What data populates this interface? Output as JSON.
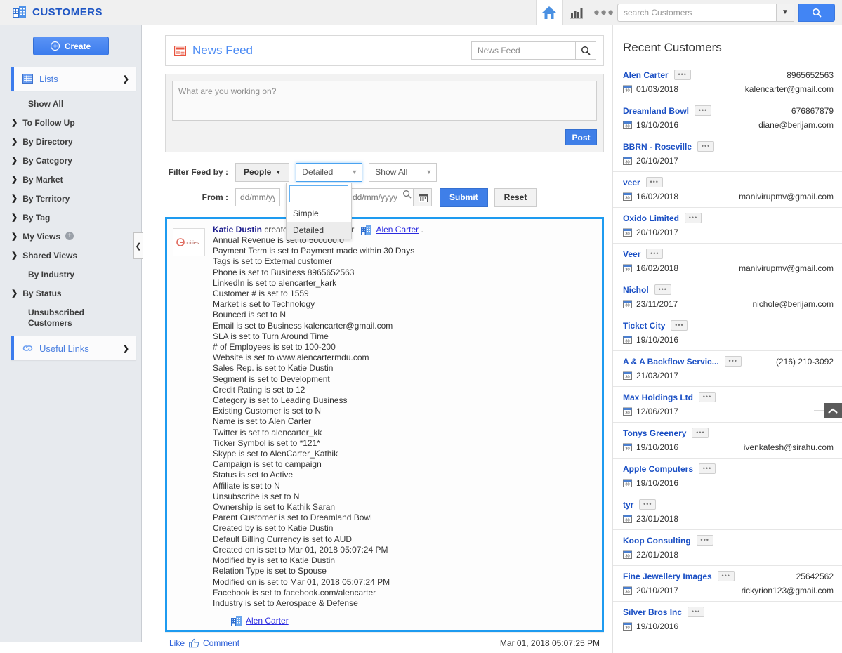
{
  "header": {
    "app_title": "CUSTOMERS",
    "brand_icon": "building-icon",
    "home_icon": "home-icon",
    "chart_icon": "bar-chart-icon",
    "more_icon": "more-dots-icon",
    "search_placeholder": "search Customers",
    "search_value": "",
    "search_caret_icon": "chevron-down-icon",
    "search_go_icon": "search-icon"
  },
  "sidebar": {
    "create_label": "Create",
    "create_icon": "plus-circle-icon",
    "lists_group": {
      "label": "Lists",
      "icon": "grid-icon",
      "chevron": "chevron-down-icon"
    },
    "items": [
      {
        "label": "Show All",
        "arrow": false
      },
      {
        "label": "To Follow Up",
        "arrow": true
      },
      {
        "label": "By Directory",
        "arrow": true
      },
      {
        "label": "By Category",
        "arrow": true
      },
      {
        "label": "By Market",
        "arrow": true
      },
      {
        "label": "By Territory",
        "arrow": true
      },
      {
        "label": "By Tag",
        "arrow": true
      },
      {
        "label": "My Views",
        "arrow": true,
        "plus": true
      },
      {
        "label": "Shared Views",
        "arrow": true
      },
      {
        "label": "By Industry",
        "arrow": false
      },
      {
        "label": "By Status",
        "arrow": true
      },
      {
        "label": "Unsubscribed Customers",
        "arrow": false
      }
    ],
    "useful_links": {
      "label": "Useful Links",
      "icon": "link-icon",
      "chevron": "chevron-right-icon"
    },
    "collapse_icon": "chevron-left-icon"
  },
  "feed": {
    "title": "News Feed",
    "title_icon": "feed-icon",
    "search_placeholder": "News Feed",
    "search_value": "",
    "search_icon": "search-icon",
    "composer_placeholder": "What are you working on?",
    "composer_value": "",
    "post_label": "Post"
  },
  "filters": {
    "label": "Filter Feed by :",
    "people_label": "People",
    "people_caret": "caret-down-icon",
    "detail_value": "Detailed",
    "detail_caret": "caret-down-icon",
    "show_value": "Show All",
    "show_caret": "caret-down-icon",
    "dropdown": {
      "search_value": "",
      "search_icon": "search-icon",
      "options": [
        "Simple",
        "Detailed"
      ],
      "selected": "Detailed"
    },
    "from_label": "From :",
    "from_placeholder": "dd/mm/yyyy",
    "from_value": "",
    "to_placeholder": "dd/mm/yyyy",
    "to_value": "",
    "calendar_icon": "calendar-icon",
    "submit_label": "Submit",
    "reset_label": "Reset"
  },
  "post": {
    "avatar_icon": "company-logo-icon",
    "actor": "Katie Dustin",
    "action": "created a new customer",
    "entity_icon": "building-icon",
    "entity": "Alen Carter",
    "period": ".",
    "lines": [
      "Annual Revenue is set to 500000.0",
      "Payment Term is set to Payment made within 30 Days",
      "Tags is set to External customer",
      "Phone is set to Business 8965652563",
      "LinkedIn is set to alencarter_kark",
      "Customer # is set to 1559",
      "Market is set to Technology",
      "Bounced is set to N",
      "Email is set to Business kalencarter@gmail.com",
      "SLA is set to Turn Around Time",
      "# of Employees is set to 100-200",
      "Website is set to www.alencartermdu.com",
      "Sales Rep. is set to Katie Dustin",
      "Segment is set to Development",
      "Credit Rating is set to 12",
      "Category is set to Leading Business",
      "Existing Customer is set to N",
      "Name is set to Alen Carter",
      "Twitter is set to alencarter_kk",
      "Ticker Symbol is set to *121*",
      "Skype is set to AlenCarter_Kathik",
      "Campaign is set to campaign",
      "Status is set to Active",
      "Affiliate is set to N",
      "Unsubscribe is set to N",
      "Ownership is set to Kathik Saran",
      "Parent Customer is set to Dreamland Bowl",
      "Created by is set to Katie Dustin",
      "Default Billing Currency is set to AUD",
      "Created on is set to Mar 01, 2018 05:07:24 PM",
      "Modified by is set to Katie Dustin",
      "Relation Type is set to Spouse",
      "Modified on is set to Mar 01, 2018 05:07:24 PM",
      "Facebook is set to facebook.com/alencarter",
      "Industry is set to Aerospace & Defense"
    ],
    "footer_entity_icon": "building-icon",
    "footer_entity": "Alen Carter",
    "like_label": "Like",
    "like_icon": "thumbs-up-icon",
    "comment_label": "Comment",
    "timestamp": "Mar 01, 2018 05:07:25 PM"
  },
  "recent": {
    "title": "Recent Customers",
    "dots_label": "•••",
    "date_icon": "calendar-icon",
    "scroll_top_icon": "chevron-up-icon",
    "customers": [
      {
        "name": "Alen Carter",
        "date": "01/03/2018",
        "phone": "8965652563",
        "email": "kalencarter@gmail.com"
      },
      {
        "name": "Dreamland Bowl",
        "date": "19/10/2016",
        "phone": "676867879",
        "email": "diane@berijam.com"
      },
      {
        "name": "BBRN - Roseville",
        "date": "20/10/2017",
        "phone": "",
        "email": ""
      },
      {
        "name": "veer",
        "date": "16/02/2018",
        "phone": "",
        "email": "manivirupmv@gmail.com"
      },
      {
        "name": "Oxido Limited",
        "date": "20/10/2017",
        "phone": "",
        "email": ""
      },
      {
        "name": "Veer",
        "date": "16/02/2018",
        "phone": "",
        "email": "manivirupmv@gmail.com"
      },
      {
        "name": "Nichol",
        "date": "23/11/2017",
        "phone": "",
        "email": "nichole@berijam.com"
      },
      {
        "name": "Ticket City",
        "date": "19/10/2016",
        "phone": "",
        "email": ""
      },
      {
        "name": "A & A Backflow Servic...",
        "date": "21/03/2017",
        "phone": "(216) 210-3092",
        "email": ""
      },
      {
        "name": "Max Holdings Ltd",
        "date": "12/06/2017",
        "phone": "",
        "email": ""
      },
      {
        "name": "Tonys Greenery",
        "date": "19/10/2016",
        "phone": "",
        "email": "ivenkatesh@sirahu.com"
      },
      {
        "name": "Apple Computers",
        "date": "19/10/2016",
        "phone": "",
        "email": ""
      },
      {
        "name": "tyr",
        "date": "23/01/2018",
        "phone": "",
        "email": ""
      },
      {
        "name": "Koop Consulting",
        "date": "22/01/2018",
        "phone": "",
        "email": ""
      },
      {
        "name": "Fine Jewellery Images",
        "date": "20/10/2017",
        "phone": "25642562",
        "email": "rickyrion123@gmail.com"
      },
      {
        "name": "Silver Bros Inc",
        "date": "19/10/2016",
        "phone": "",
        "email": ""
      }
    ]
  },
  "colors": {
    "accent": "#3f7fe8",
    "link": "#2b2be0",
    "brand": "#1f56c4",
    "highlight": "#1e9bf0"
  }
}
